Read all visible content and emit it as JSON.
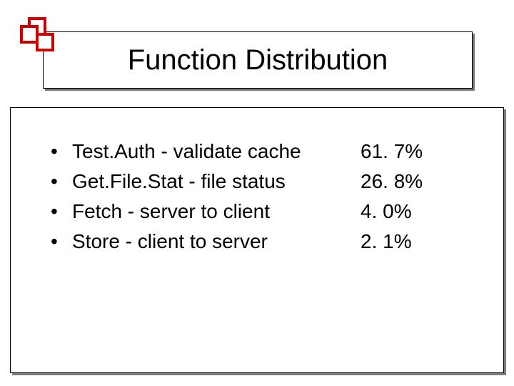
{
  "title": "Function Distribution",
  "items": [
    {
      "label": "Test.Auth - validate cache",
      "value": "61. 7%"
    },
    {
      "label": "Get.File.Stat - file status",
      "value": "26. 8%"
    },
    {
      "label": "Fetch - server to client",
      "value": "4. 0%"
    },
    {
      "label": "Store - client to server",
      "value": "2. 1%"
    }
  ],
  "bullet": "•"
}
